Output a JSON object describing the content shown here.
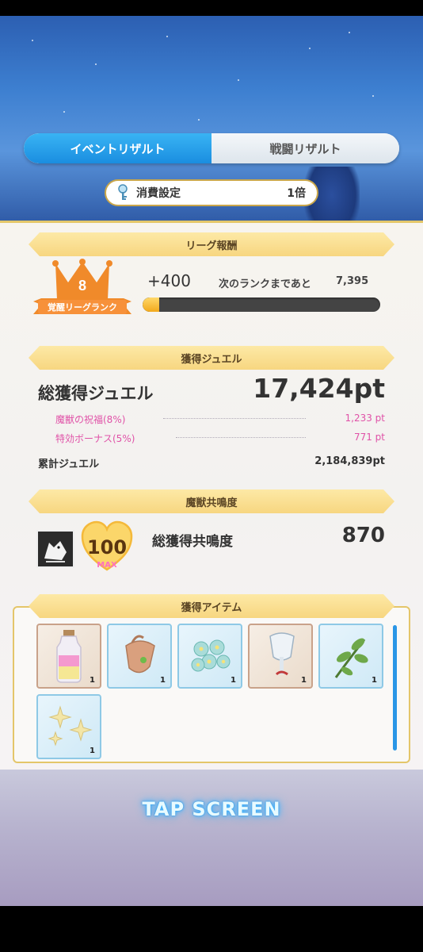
{
  "tabs": {
    "event_result": "イベントリザルト",
    "battle_result": "戦闘リザルト"
  },
  "consume": {
    "label": "消費設定",
    "value": "1倍"
  },
  "league": {
    "section_title": "リーグ報酬",
    "rank_number": "8",
    "rank_label": "覚醒リーグランク",
    "points_gained": "+400",
    "next_rank_label": "次のランクまであと",
    "next_rank_value": "7,395",
    "progress_fraction": 0.07
  },
  "jewel": {
    "section_title": "獲得ジュエル",
    "total_label": "総獲得ジュエル",
    "total_value": "17,424pt",
    "bonuses": [
      {
        "label": "魔獣の祝福(8%)",
        "value": "1,233 pt"
      },
      {
        "label": "特効ボーナス(5%)",
        "value": "771 pt"
      }
    ],
    "cumulative_label": "累計ジュエル",
    "cumulative_value": "2,184,839pt"
  },
  "resonance": {
    "section_title": "魔獣共鳴度",
    "heart_value": "100",
    "heart_max": "MAX",
    "total_label": "総獲得共鳴度",
    "total_value": "870"
  },
  "items": {
    "section_title": "獲得アイテム",
    "list": [
      {
        "icon": "potion-bottle-icon",
        "qty": "1"
      },
      {
        "icon": "cloth-pouch-icon",
        "qty": "1"
      },
      {
        "icon": "flower-bouquet-icon",
        "qty": "1"
      },
      {
        "icon": "bell-flower-icon",
        "qty": "1"
      },
      {
        "icon": "green-sprig-icon",
        "qty": "1"
      },
      {
        "icon": "sparkle-stars-icon",
        "qty": "1"
      }
    ]
  },
  "footer": {
    "tap_screen": "TAP SCREEN"
  },
  "colors": {
    "accent_blue": "#1a8ee0",
    "gold": "#e4c66a",
    "pink_bonus": "#e052a8",
    "crown_orange": "#f08a2a"
  }
}
